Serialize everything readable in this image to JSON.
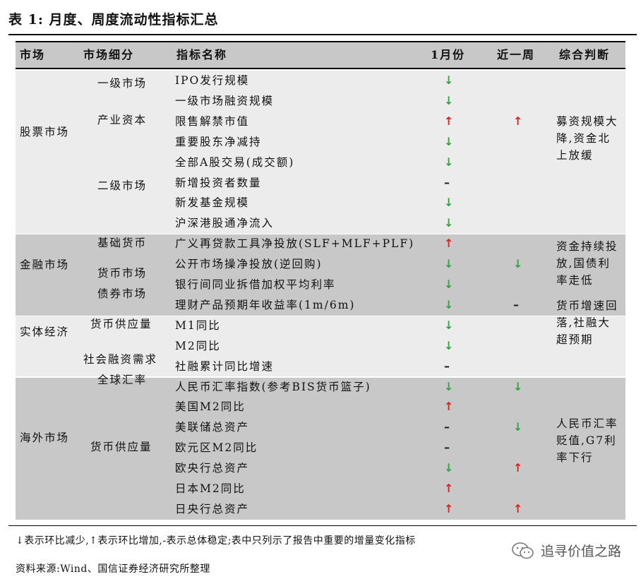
{
  "title": "表 1:  月度、周度流动性指标汇总",
  "headers": {
    "market": "市场",
    "submarket": "市场细分",
    "indicator": "指标名称",
    "january": "1月份",
    "recent_week": "近一周",
    "judgment": "综合判断"
  },
  "colors": {
    "up": "#e0201b",
    "down": "#2ca83c",
    "band_dark": "#c8c8c8",
    "band_light": "#ececec"
  },
  "markets": [
    {
      "name": "股票市场",
      "judgment": "募资规模大\n降,资金北\n上放缓"
    },
    {
      "name": "金融市场",
      "judgment": "资金持续投\n放,国债利\n率走低"
    },
    {
      "name": "实体经济",
      "judgment": "货币增速回\n落,社融大\n超预期"
    },
    {
      "name": "海外市场",
      "judgment": "人民币汇率\n贬值,G7利\n率下行"
    }
  ],
  "submarkets": [
    "一级市场",
    "产业资本",
    "二级市场",
    "基础货币",
    "货币市场",
    "债券市场",
    "货币供应量",
    "社会融资需求",
    "全球汇率",
    "货币供应量"
  ],
  "rows": [
    {
      "indicator": "IPO发行规模",
      "m": "↓",
      "w": ""
    },
    {
      "indicator": "一级市场融资规模",
      "m": "↓",
      "w": ""
    },
    {
      "indicator": "限售解禁市值",
      "m": "↑",
      "w": "↑"
    },
    {
      "indicator": "重要股东净减持",
      "m": "↓",
      "w": ""
    },
    {
      "indicator": "全部A股交易(成交额)",
      "m": "↓",
      "w": ""
    },
    {
      "indicator": "新增投资者数量",
      "m": "–",
      "w": ""
    },
    {
      "indicator": "新发基金规模",
      "m": "↓",
      "w": ""
    },
    {
      "indicator": "沪深港股通净流入",
      "m": "↓",
      "w": ""
    },
    {
      "indicator": "广义再贷款工具净投放(SLF+MLF+PLF)",
      "m": "↑",
      "w": ""
    },
    {
      "indicator": "公开市场操净投放(逆回购)",
      "m": "↓",
      "w": "↓"
    },
    {
      "indicator": "银行间同业拆借加权平均利率",
      "m": "↓",
      "w": ""
    },
    {
      "indicator": "理财产品预期年收益率(1m/6m)",
      "m": "↓",
      "w": "–"
    },
    {
      "indicator": "M1同比",
      "m": "↓",
      "w": ""
    },
    {
      "indicator": "M2同比",
      "m": "↓",
      "w": ""
    },
    {
      "indicator": "社融累计同比增速",
      "m": "–",
      "w": ""
    },
    {
      "indicator": "人民币汇率指数(参考BIS货币篮子)",
      "m": "↓",
      "w": "↓"
    },
    {
      "indicator": "美国M2同比",
      "m": "↑",
      "w": ""
    },
    {
      "indicator": "美联储总资产",
      "m": "–",
      "w": "↓"
    },
    {
      "indicator": "欧元区M2同比",
      "m": "–",
      "w": ""
    },
    {
      "indicator": "欧央行总资产",
      "m": "↓",
      "w": "↑"
    },
    {
      "indicator": "日本M2同比",
      "m": "↑",
      "w": ""
    },
    {
      "indicator": "日央行总资产",
      "m": "↑",
      "w": "↑"
    }
  ],
  "note": "↓表示环比减少,↑表示环比增加,-表示总体稳定;表中只列示了报告中重要的增量变化指标",
  "source": "资料来源:Wind、国信证券经济研究所整理",
  "watermark": "追寻价值之路"
}
